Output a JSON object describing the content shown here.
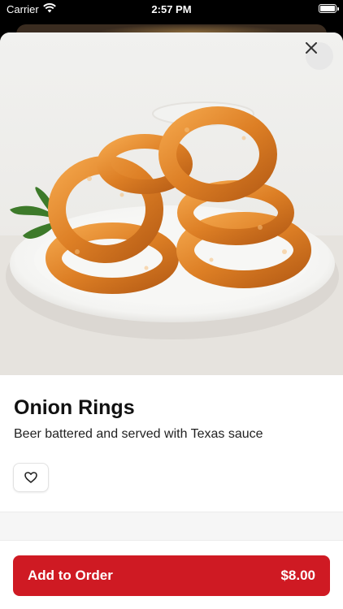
{
  "status_bar": {
    "carrier": "Carrier",
    "time": "2:57 PM",
    "icons": [
      "wifi-icon",
      "battery-icon"
    ]
  },
  "item": {
    "name": "Onion Rings",
    "description": "Beer battered and served with Texas sauce",
    "image": "onion-rings-photo"
  },
  "actions": {
    "close_icon": "close-icon",
    "favorite_icon": "heart-icon",
    "add_label": "Add to Order",
    "price": "$8.00"
  },
  "colors": {
    "accent": "#cf1a23",
    "text_primary": "#111111",
    "sheet_bg": "#ffffff"
  }
}
